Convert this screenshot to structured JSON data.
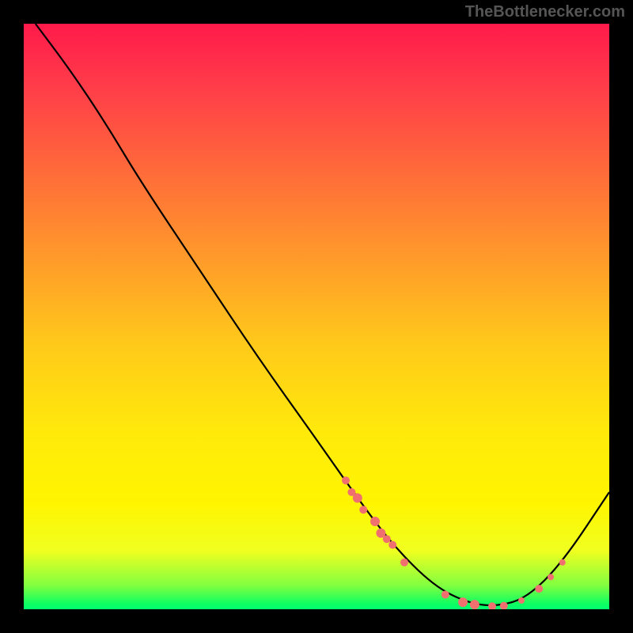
{
  "watermark": "TheBottlenecker.com",
  "chart_data": {
    "type": "line",
    "title": "",
    "xlabel": "",
    "ylabel": "",
    "xlim": [
      0,
      100
    ],
    "ylim": [
      0,
      100
    ],
    "curve": {
      "name": "bottleneck-curve",
      "points": [
        {
          "x": 2,
          "y": 100
        },
        {
          "x": 8,
          "y": 92
        },
        {
          "x": 14,
          "y": 83
        },
        {
          "x": 20,
          "y": 73
        },
        {
          "x": 30,
          "y": 58
        },
        {
          "x": 40,
          "y": 43
        },
        {
          "x": 50,
          "y": 29
        },
        {
          "x": 57,
          "y": 19
        },
        {
          "x": 63,
          "y": 11
        },
        {
          "x": 70,
          "y": 4
        },
        {
          "x": 76,
          "y": 1
        },
        {
          "x": 81,
          "y": 0.5
        },
        {
          "x": 86,
          "y": 2
        },
        {
          "x": 92,
          "y": 8
        },
        {
          "x": 100,
          "y": 20
        }
      ]
    },
    "markers": [
      {
        "x": 55,
        "y": 22,
        "r": 5
      },
      {
        "x": 56,
        "y": 20,
        "r": 5
      },
      {
        "x": 57,
        "y": 19,
        "r": 6
      },
      {
        "x": 58,
        "y": 17,
        "r": 5
      },
      {
        "x": 60,
        "y": 15,
        "r": 6
      },
      {
        "x": 61,
        "y": 13,
        "r": 6
      },
      {
        "x": 62,
        "y": 12,
        "r": 5
      },
      {
        "x": 63,
        "y": 11,
        "r": 5
      },
      {
        "x": 65,
        "y": 8,
        "r": 5
      },
      {
        "x": 72,
        "y": 2.5,
        "r": 5
      },
      {
        "x": 75,
        "y": 1.2,
        "r": 6
      },
      {
        "x": 77,
        "y": 0.8,
        "r": 6
      },
      {
        "x": 80,
        "y": 0.5,
        "r": 5
      },
      {
        "x": 82,
        "y": 0.6,
        "r": 5
      },
      {
        "x": 85,
        "y": 1.5,
        "r": 4
      },
      {
        "x": 88,
        "y": 3.5,
        "r": 5
      },
      {
        "x": 90,
        "y": 5.5,
        "r": 4
      },
      {
        "x": 92,
        "y": 8,
        "r": 4
      }
    ],
    "marker_color": "#f07070",
    "curve_color": "#000000",
    "gradient_stops": [
      {
        "pos": 0,
        "color": "#ff1a4a"
      },
      {
        "pos": 100,
        "color": "#00ff70"
      }
    ]
  }
}
